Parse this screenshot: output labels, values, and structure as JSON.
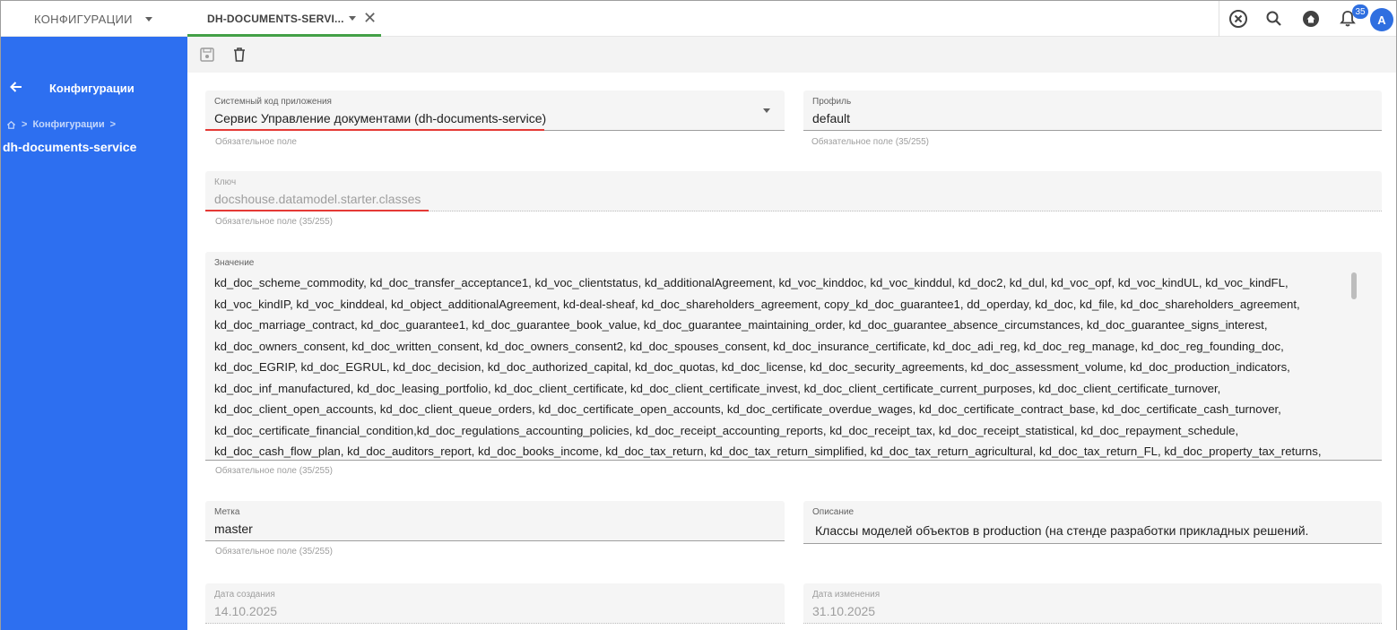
{
  "topbar": {
    "menu_label": "КОНФИГУРАЦИИ",
    "tab_label": "DH-DOCUMENTS-SERVI...",
    "notifications_count": "35",
    "avatar_initial": "A"
  },
  "sidebar": {
    "title": "Конфигурации",
    "breadcrumb_separator": ">",
    "breadcrumb_parent": "Конфигурации",
    "breadcrumb_current": "dh-documents-service"
  },
  "form": {
    "app_code": {
      "label": "Системный код приложения",
      "value": "Сервис Управление документами (dh-documents-service)",
      "hint": "Обязательное поле"
    },
    "profile": {
      "label": "Профиль",
      "value": "default",
      "hint": "Обязательное поле (35/255)"
    },
    "key": {
      "label": "Ключ",
      "value": "docshouse.datamodel.starter.classes",
      "hint": "Обязательное поле (35/255)"
    },
    "value_field": {
      "label": "Значение",
      "lines": [
        "kd_doc_scheme_commodity, kd_doc_transfer_acceptance1, kd_voc_clientstatus, kd_additionalAgreement, kd_voc_kinddoc, kd_voc_kinddul, kd_doc2, kd_dul, kd_voc_opf, kd_voc_kindUL, kd_voc_kindFL,",
        "kd_voc_kindIP,  kd_voc_kinddeal, kd_object_additionalAgreement,  kd-deal-sheaf,  kd_doc_shareholders_agreement, copy_kd_doc_guarantee1, dd_operday, kd_doc, kd_file, kd_doc_shareholders_agreement,",
        "kd_doc_marriage_contract, kd_doc_guarantee1, kd_doc_guarantee_book_value, kd_doc_guarantee_maintaining_order, kd_doc_guarantee_absence_circumstances, kd_doc_guarantee_signs_interest,",
        "kd_doc_owners_consent, kd_doc_written_consent, kd_doc_owners_consent2, kd_doc_spouses_consent, kd_doc_insurance_certificate, kd_doc_adi_reg, kd_doc_reg_manage, kd_doc_reg_founding_doc,",
        "kd_doc_EGRIP, kd_doc_EGRUL, kd_doc_decision, kd_doc_authorized_capital, kd_doc_quotas, kd_doc_license, kd_doc_security_agreements, kd_doc_assessment_volume, kd_doc_production_indicators,",
        "kd_doc_inf_manufactured, kd_doc_leasing_portfolio, kd_doc_client_certificate, kd_doc_client_certificate_invest, kd_doc_client_certificate_current_purposes, kd_doc_client_certificate_turnover,",
        "kd_doc_client_open_accounts, kd_doc_client_queue_orders, kd_doc_certificate_open_accounts, kd_doc_certificate_overdue_wages, kd_doc_certificate_contract_base, kd_doc_certificate_cash_turnover,",
        "kd_doc_certificate_financial_condition,kd_doc_regulations_accounting_policies, kd_doc_receipt_accounting_reports, kd_doc_receipt_tax, kd_doc_receipt_statistical, kd_doc_repayment_schedule,",
        "kd_doc_cash_flow_plan, kd_doc_auditors_report, kd_doc_books_income, kd_doc_tax_return, kd_doc_tax_return_simplified, kd_doc_tax_return_agricultural, kd_doc_tax_return_FL, kd_doc_property_tax_returns,"
      ],
      "hint": "Обязательное поле (35/255)"
    },
    "label_field": {
      "label": "Метка",
      "value": "master",
      "hint": "Обязательное поле (35/255)"
    },
    "description": {
      "label": "Описание",
      "value": "Классы моделей объектов в production (на стенде разработки прикладных решений."
    },
    "created": {
      "label": "Дата создания",
      "value": "14.10.2025"
    },
    "modified": {
      "label": "Дата изменения",
      "value": "31.10.2025"
    }
  },
  "colors": {
    "sidebar": "#2d6ff0",
    "tab_underline": "#43a047",
    "error_underline": "#e53935",
    "badge": "#2f6fe0"
  },
  "icons": [
    "caret-down-icon",
    "close-icon",
    "cancel-circle-icon",
    "search-icon",
    "home-icon",
    "bell-icon",
    "back-arrow-icon",
    "home-small-icon",
    "save-icon",
    "delete-icon"
  ]
}
